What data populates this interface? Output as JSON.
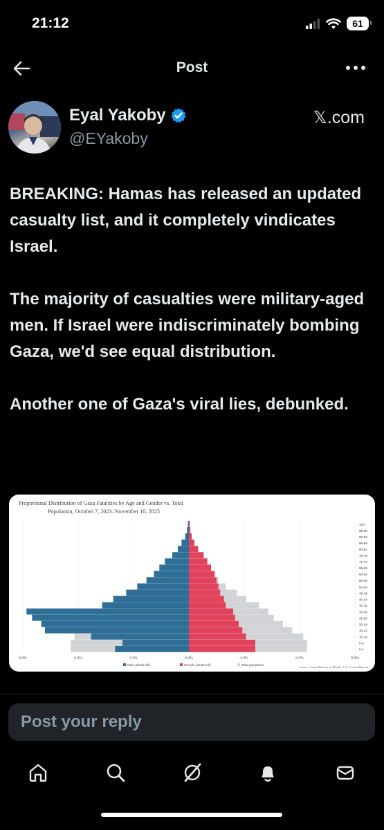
{
  "status": {
    "time": "21:12",
    "battery": "61"
  },
  "header": {
    "title": "Post"
  },
  "author": {
    "name": "Eyal Yakoby",
    "handle": "@EYakoby",
    "source": "𝕏.com"
  },
  "post": {
    "paragraphs": [
      "BREAKING: Hamas has released an updated casualty list, and it completely vindicates Israel.",
      "The majority of casualties were military-aged men. If Israel were indiscriminately bombing Gaza, we'd see equal distribution.",
      "Another one of Gaza's viral lies, debunked."
    ]
  },
  "chart_data": {
    "type": "bar",
    "orientation": "horizontal-pyramid",
    "title": "Proportional Distribution of Gaza Fatalities by Age and Gender vs. Total",
    "subtitle": "Population, October 7, 2023–November 10, 2025",
    "source": "Source: Gaza Ministry of Health, U.S. Census Bureau",
    "x_ticks": [
      "9.0%",
      "6.0%",
      "3.0%",
      "0.0%",
      "3.0%",
      "6.0%",
      "9.0%"
    ],
    "xlim": [
      -9,
      9
    ],
    "categories": [
      "100-",
      "95-99",
      "90-94",
      "85-89",
      "80-84",
      "75-79",
      "70-74",
      "65-69",
      "60-64",
      "55-59",
      "50-54",
      "45-49",
      "40-44",
      "35-39",
      "30-34",
      "25-29",
      "20-24",
      "15-19",
      "10-14",
      "5-9",
      "0-4"
    ],
    "series": [
      {
        "name": "Male (death toll)",
        "color": "#2f6e96",
        "values": [
          0.05,
          0.1,
          0.2,
          0.4,
          0.6,
          0.9,
          1.3,
          1.6,
          1.9,
          2.3,
          2.8,
          3.4,
          4.1,
          4.7,
          8.8,
          8.5,
          8.0,
          7.8,
          5.3,
          3.6,
          4.0
        ]
      },
      {
        "name": "Female (death toll)",
        "color": "#e1435d",
        "values": [
          0.05,
          0.08,
          0.15,
          0.3,
          0.5,
          0.8,
          1.0,
          1.2,
          1.4,
          1.5,
          1.6,
          1.7,
          1.9,
          2.0,
          2.4,
          2.5,
          2.7,
          2.9,
          3.1,
          3.6,
          3.6
        ]
      },
      {
        "name": "Total population",
        "color": "#d2d3d6",
        "values": [
          0.02,
          0.05,
          0.1,
          0.2,
          0.3,
          0.5,
          0.8,
          1.0,
          1.3,
          1.6,
          2.0,
          2.6,
          3.1,
          3.8,
          4.3,
          4.6,
          5.1,
          5.6,
          6.2,
          6.4,
          6.4
        ]
      }
    ]
  },
  "reply": {
    "placeholder": "Post your reply"
  },
  "nav": [
    "home-icon",
    "search-icon",
    "grok-icon",
    "notifications-icon",
    "messages-icon"
  ]
}
